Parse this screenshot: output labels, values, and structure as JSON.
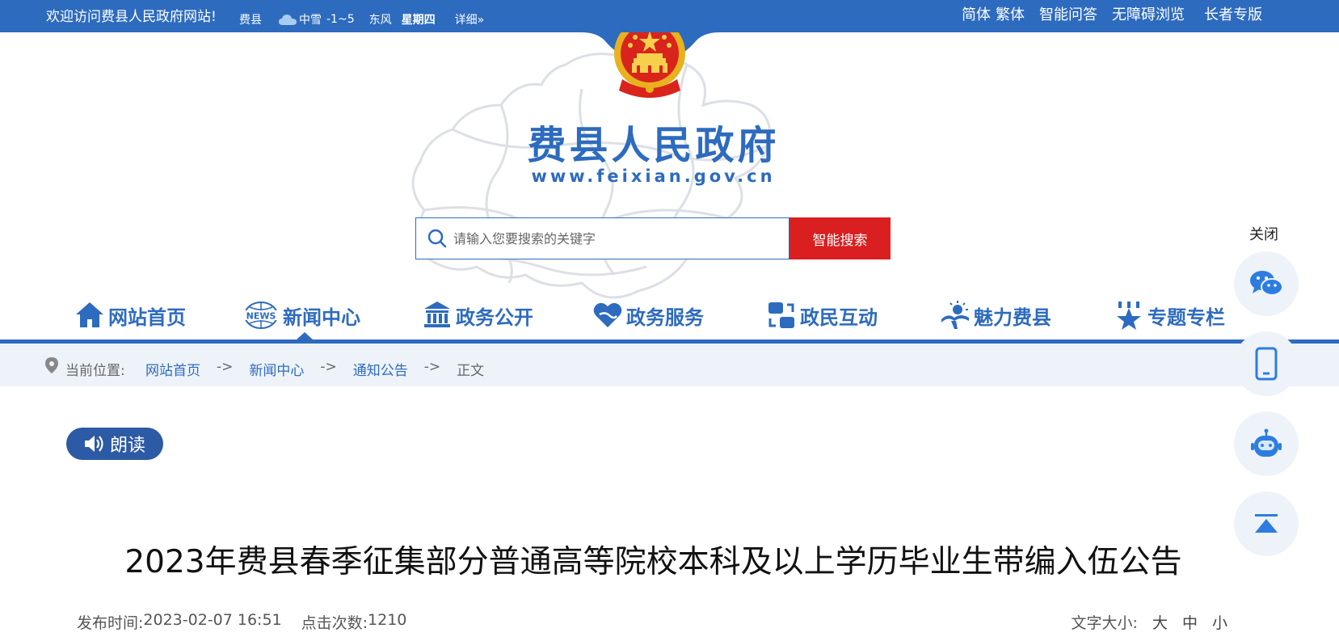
{
  "topbar": {
    "welcome": "欢迎访问费县人民政府网站!",
    "weather": {
      "city": "费县",
      "condition": "中雪",
      "temperature": "-1~5",
      "wind": "东风",
      "weekday": "星期四",
      "details": "详细»"
    },
    "links": [
      "简体",
      "繁体",
      "智能问答",
      "无障碍浏览",
      "长者专版"
    ]
  },
  "header": {
    "title": "费县人民政府",
    "url": "www.feixian.gov.cn"
  },
  "search": {
    "placeholder": "请输入您要搜索的关键字",
    "button": "智能搜索"
  },
  "nav": {
    "items": [
      {
        "label": "网站首页",
        "icon": "home-icon"
      },
      {
        "label": "新闻中心",
        "icon": "news-icon"
      },
      {
        "label": "政务公开",
        "icon": "government-building-icon"
      },
      {
        "label": "政务服务",
        "icon": "heart-hands-icon"
      },
      {
        "label": "政民互动",
        "icon": "interaction-icon"
      },
      {
        "label": "魅力费县",
        "icon": "scenery-icon"
      },
      {
        "label": "专题专栏",
        "icon": "star-icon"
      }
    ],
    "active": "新闻中心"
  },
  "breadcrumb": {
    "prefix": "当前位置:",
    "items": [
      "网站首页",
      "新闻中心",
      "通知公告"
    ],
    "current": "正文",
    "separator": "->"
  },
  "article": {
    "read_button": "朗读",
    "title": "2023年费县春季征集部分普通高等院校本科及以上学历毕业生带编入伍公告",
    "publish_label": "发布时间:",
    "publish_time": "2023-02-07 16:51",
    "clicks_label": "点击次数:",
    "clicks": "1210",
    "font_size_label": "文字大小:",
    "font_sizes": [
      "大",
      "中",
      "小"
    ]
  },
  "float_bar": {
    "close": "关闭",
    "buttons": [
      "wechat-icon",
      "mobile-icon",
      "robot-icon",
      "back-to-top-icon"
    ]
  },
  "colors": {
    "primary": "#2d6bbf",
    "search_button": "#d91f1f",
    "breadcrumb_bg": "#eef3fa"
  }
}
